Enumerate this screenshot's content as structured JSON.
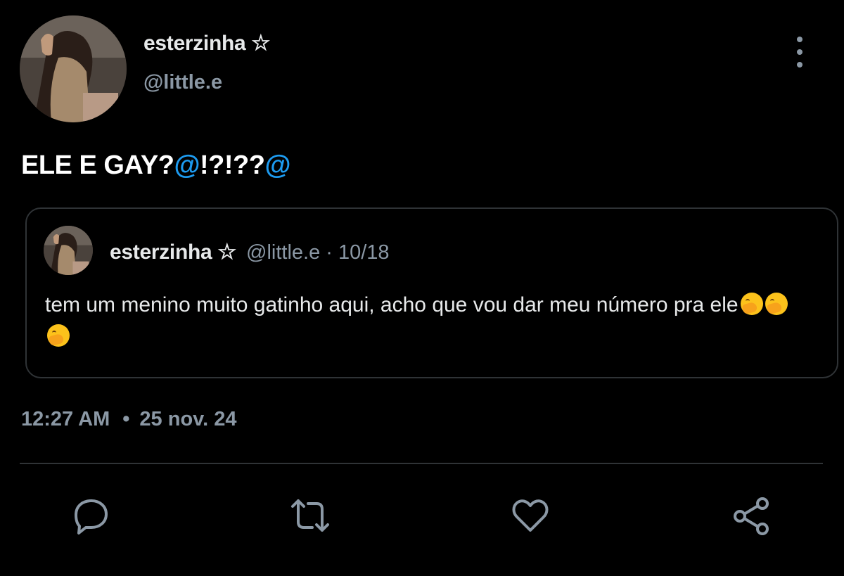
{
  "author": {
    "name": "esterzinha ☆",
    "handle": "@little.e"
  },
  "tweet": {
    "text_plain": "ELE E GAY?",
    "text_mention_1": "@",
    "text_middle": "!?!??",
    "text_mention_2": "@"
  },
  "quoted_tweet": {
    "name": "esterzinha ☆",
    "meta": "@little.e · 10/18",
    "text": "tem um menino muito gatinho aqui, acho que vou dar meu número pra ele",
    "emoji_count": 3
  },
  "timestamp": {
    "time": "12:27 AM",
    "separator": "•",
    "date": "25 nov. 24"
  },
  "actions": [
    "reply-icon",
    "retweet-icon",
    "like-icon",
    "share-icon"
  ],
  "colors": {
    "background": "#000000",
    "text": "#e7e9ea",
    "secondary": "#8b98a5",
    "accent": "#1d9bf0",
    "border": "#2f3336"
  }
}
